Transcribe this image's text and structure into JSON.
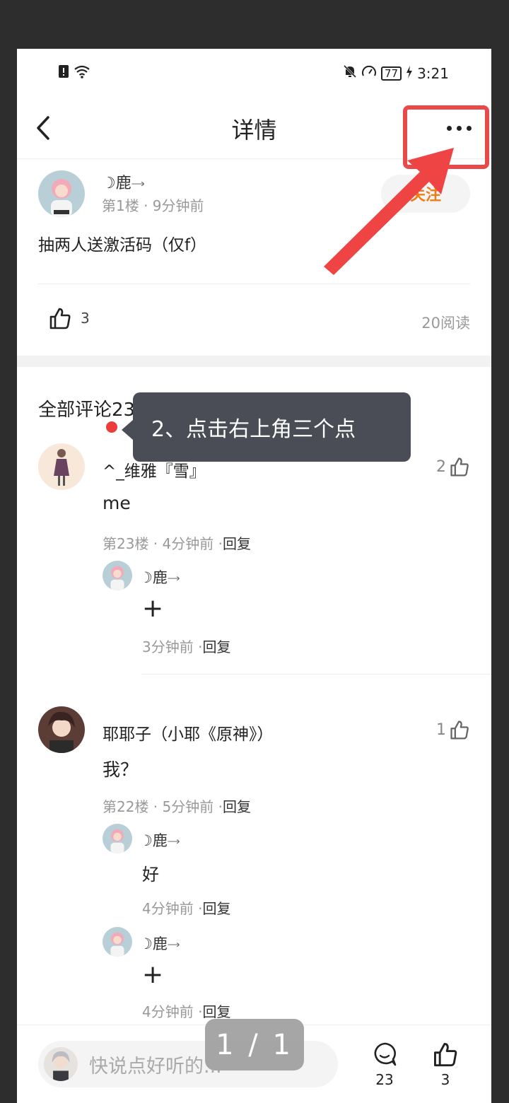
{
  "status_bar": {
    "battery": "77",
    "time": "3:21"
  },
  "nav": {
    "title": "详情"
  },
  "post": {
    "author": "☽鹿",
    "author_suffix": "𐃘",
    "floor_time": "第1楼 · 9分钟前",
    "follow_label": "关注",
    "content": "抽两人送激活码（仅f）",
    "likes": "3",
    "reads": "20阅读"
  },
  "comments_title": "全部评论23",
  "tooltip": "2、点击右上角三个点",
  "comments": [
    {
      "name": "^_维雅『雪』",
      "text": "me",
      "meta": "第23楼 · 4分钟前 ·",
      "reply_label": "回复",
      "likes": "2",
      "replies": [
        {
          "name": "☽鹿",
          "text": "+",
          "meta": "3分钟前 ·",
          "reply_label": "回复"
        }
      ]
    },
    {
      "name": "耶耶子（小耶《原神》）",
      "text": "我？",
      "meta": "第22楼 · 5分钟前 ·",
      "reply_label": "回复",
      "likes": "1",
      "replies": [
        {
          "name": "☽鹿",
          "text": "好",
          "meta": "4分钟前 ·",
          "reply_label": "回复"
        },
        {
          "name": "☽鹿",
          "text": "+",
          "meta": "4分钟前 ·",
          "reply_label": "回复"
        }
      ]
    }
  ],
  "bottom_bar": {
    "input_placeholder": "快说点好听的...",
    "comment_count": "23",
    "like_count": "3"
  },
  "page_indicator": "1 / 1",
  "colors": {
    "accent": "#f07c16",
    "highlight": "#e84a4a",
    "tooltip_bg": "#4a4d55"
  }
}
